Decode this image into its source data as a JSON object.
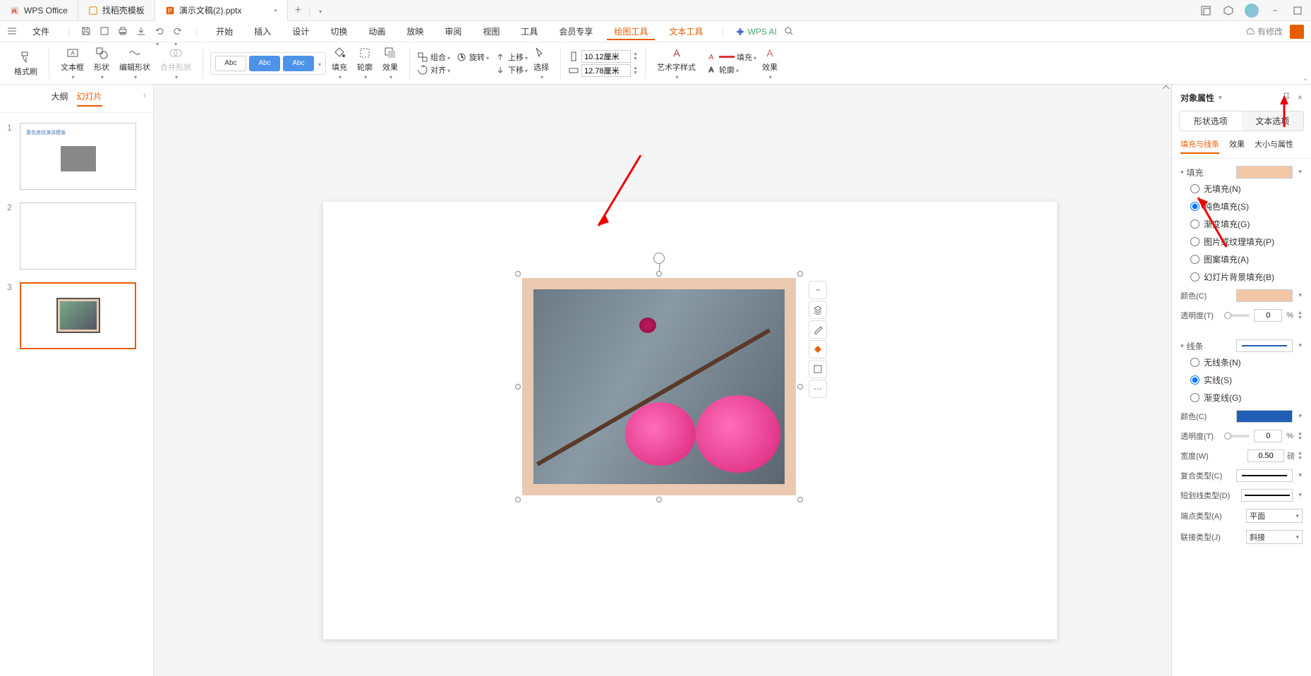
{
  "titlebar": {
    "app_name": "WPS Office",
    "tab_template": "找稻壳模板",
    "tab_doc": "演示文稿(2).pptx"
  },
  "winbtns": {
    "minimize": "−",
    "close": "×"
  },
  "menubar": {
    "file": "文件",
    "items": [
      "开始",
      "插入",
      "设计",
      "切换",
      "动画",
      "放映",
      "审阅",
      "视图",
      "工具",
      "会员专享",
      "绘图工具",
      "文本工具"
    ],
    "ai": "WPS AI",
    "modify": "有修改"
  },
  "ribbon": {
    "format_painter": "格式刷",
    "textbox": "文本框",
    "shape": "形状",
    "edit_shape": "编辑形状",
    "merge_shape": "合并形状",
    "preset_label": "Abc",
    "fill": "填充",
    "outline": "轮廓",
    "effect": "效果",
    "group": "组合",
    "rotate": "旋转",
    "align": "对齐",
    "up": "上移",
    "down": "下移",
    "select": "选择",
    "height": "10.12厘米",
    "width": "12.78厘米",
    "art_style": "艺术字样式",
    "fill2": "填充",
    "outline2": "轮廓",
    "effect2": "效果"
  },
  "slidepanel": {
    "outline": "大纲",
    "slides": "幻灯片",
    "thumb1_text": "童色底纹演讲模版"
  },
  "props": {
    "title": "对象属性",
    "tab_shape": "形状选项",
    "tab_text": "文本选项",
    "sub_fill_line": "填充与线条",
    "sub_effect": "效果",
    "sub_size": "大小与属性",
    "fill_section": "填充",
    "no_fill": "无填充(N)",
    "solid_fill": "纯色填充(S)",
    "gradient_fill": "渐变填充(G)",
    "pic_fill": "图片或纹理填充(P)",
    "pattern_fill": "图案填充(A)",
    "slide_bg_fill": "幻灯片背景填充(B)",
    "color": "颜色(C)",
    "transparency": "透明度(T)",
    "trans_val": "0",
    "percent": "%",
    "line_section": "线条",
    "no_line": "无线条(N)",
    "solid_line": "实线(S)",
    "gradient_line": "渐变线(G)",
    "width_label": "宽度(W)",
    "width_val": "0.50",
    "width_unit": "磅",
    "compound": "复合类型(C)",
    "dash": "短划线类型(D)",
    "cap": "端点类型(A)",
    "cap_val": "平面",
    "join": "联接类型(J)",
    "join_val": "斜接"
  },
  "colors": {
    "peach": "#f2c7a8",
    "blue": "#205fb5"
  }
}
